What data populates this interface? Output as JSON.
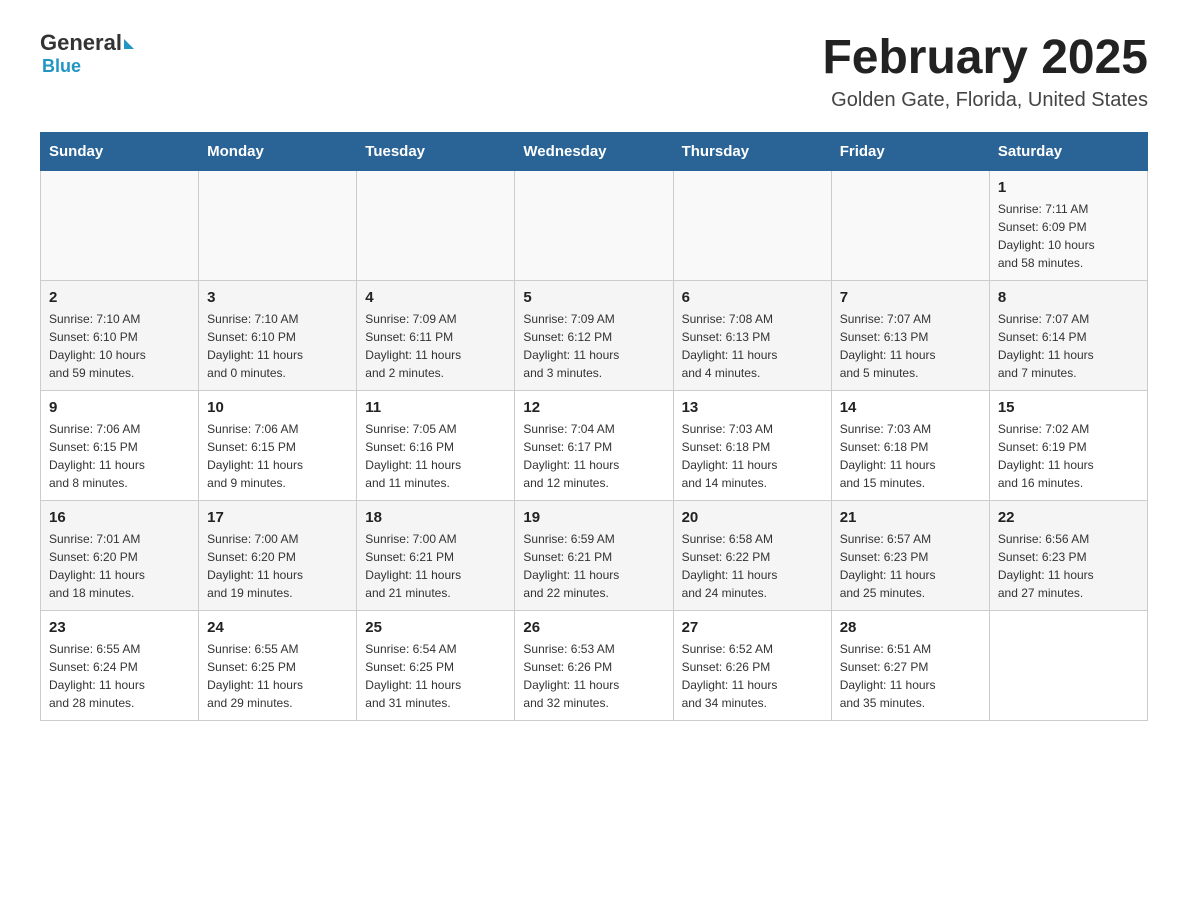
{
  "header": {
    "logo_general": "General",
    "logo_blue": "Blue",
    "month_title": "February 2025",
    "location": "Golden Gate, Florida, United States"
  },
  "weekdays": [
    "Sunday",
    "Monday",
    "Tuesday",
    "Wednesday",
    "Thursday",
    "Friday",
    "Saturday"
  ],
  "weeks": [
    [
      {
        "day": "",
        "info": ""
      },
      {
        "day": "",
        "info": ""
      },
      {
        "day": "",
        "info": ""
      },
      {
        "day": "",
        "info": ""
      },
      {
        "day": "",
        "info": ""
      },
      {
        "day": "",
        "info": ""
      },
      {
        "day": "1",
        "info": "Sunrise: 7:11 AM\nSunset: 6:09 PM\nDaylight: 10 hours\nand 58 minutes."
      }
    ],
    [
      {
        "day": "2",
        "info": "Sunrise: 7:10 AM\nSunset: 6:10 PM\nDaylight: 10 hours\nand 59 minutes."
      },
      {
        "day": "3",
        "info": "Sunrise: 7:10 AM\nSunset: 6:10 PM\nDaylight: 11 hours\nand 0 minutes."
      },
      {
        "day": "4",
        "info": "Sunrise: 7:09 AM\nSunset: 6:11 PM\nDaylight: 11 hours\nand 2 minutes."
      },
      {
        "day": "5",
        "info": "Sunrise: 7:09 AM\nSunset: 6:12 PM\nDaylight: 11 hours\nand 3 minutes."
      },
      {
        "day": "6",
        "info": "Sunrise: 7:08 AM\nSunset: 6:13 PM\nDaylight: 11 hours\nand 4 minutes."
      },
      {
        "day": "7",
        "info": "Sunrise: 7:07 AM\nSunset: 6:13 PM\nDaylight: 11 hours\nand 5 minutes."
      },
      {
        "day": "8",
        "info": "Sunrise: 7:07 AM\nSunset: 6:14 PM\nDaylight: 11 hours\nand 7 minutes."
      }
    ],
    [
      {
        "day": "9",
        "info": "Sunrise: 7:06 AM\nSunset: 6:15 PM\nDaylight: 11 hours\nand 8 minutes."
      },
      {
        "day": "10",
        "info": "Sunrise: 7:06 AM\nSunset: 6:15 PM\nDaylight: 11 hours\nand 9 minutes."
      },
      {
        "day": "11",
        "info": "Sunrise: 7:05 AM\nSunset: 6:16 PM\nDaylight: 11 hours\nand 11 minutes."
      },
      {
        "day": "12",
        "info": "Sunrise: 7:04 AM\nSunset: 6:17 PM\nDaylight: 11 hours\nand 12 minutes."
      },
      {
        "day": "13",
        "info": "Sunrise: 7:03 AM\nSunset: 6:18 PM\nDaylight: 11 hours\nand 14 minutes."
      },
      {
        "day": "14",
        "info": "Sunrise: 7:03 AM\nSunset: 6:18 PM\nDaylight: 11 hours\nand 15 minutes."
      },
      {
        "day": "15",
        "info": "Sunrise: 7:02 AM\nSunset: 6:19 PM\nDaylight: 11 hours\nand 16 minutes."
      }
    ],
    [
      {
        "day": "16",
        "info": "Sunrise: 7:01 AM\nSunset: 6:20 PM\nDaylight: 11 hours\nand 18 minutes."
      },
      {
        "day": "17",
        "info": "Sunrise: 7:00 AM\nSunset: 6:20 PM\nDaylight: 11 hours\nand 19 minutes."
      },
      {
        "day": "18",
        "info": "Sunrise: 7:00 AM\nSunset: 6:21 PM\nDaylight: 11 hours\nand 21 minutes."
      },
      {
        "day": "19",
        "info": "Sunrise: 6:59 AM\nSunset: 6:21 PM\nDaylight: 11 hours\nand 22 minutes."
      },
      {
        "day": "20",
        "info": "Sunrise: 6:58 AM\nSunset: 6:22 PM\nDaylight: 11 hours\nand 24 minutes."
      },
      {
        "day": "21",
        "info": "Sunrise: 6:57 AM\nSunset: 6:23 PM\nDaylight: 11 hours\nand 25 minutes."
      },
      {
        "day": "22",
        "info": "Sunrise: 6:56 AM\nSunset: 6:23 PM\nDaylight: 11 hours\nand 27 minutes."
      }
    ],
    [
      {
        "day": "23",
        "info": "Sunrise: 6:55 AM\nSunset: 6:24 PM\nDaylight: 11 hours\nand 28 minutes."
      },
      {
        "day": "24",
        "info": "Sunrise: 6:55 AM\nSunset: 6:25 PM\nDaylight: 11 hours\nand 29 minutes."
      },
      {
        "day": "25",
        "info": "Sunrise: 6:54 AM\nSunset: 6:25 PM\nDaylight: 11 hours\nand 31 minutes."
      },
      {
        "day": "26",
        "info": "Sunrise: 6:53 AM\nSunset: 6:26 PM\nDaylight: 11 hours\nand 32 minutes."
      },
      {
        "day": "27",
        "info": "Sunrise: 6:52 AM\nSunset: 6:26 PM\nDaylight: 11 hours\nand 34 minutes."
      },
      {
        "day": "28",
        "info": "Sunrise: 6:51 AM\nSunset: 6:27 PM\nDaylight: 11 hours\nand 35 minutes."
      },
      {
        "day": "",
        "info": ""
      }
    ]
  ]
}
